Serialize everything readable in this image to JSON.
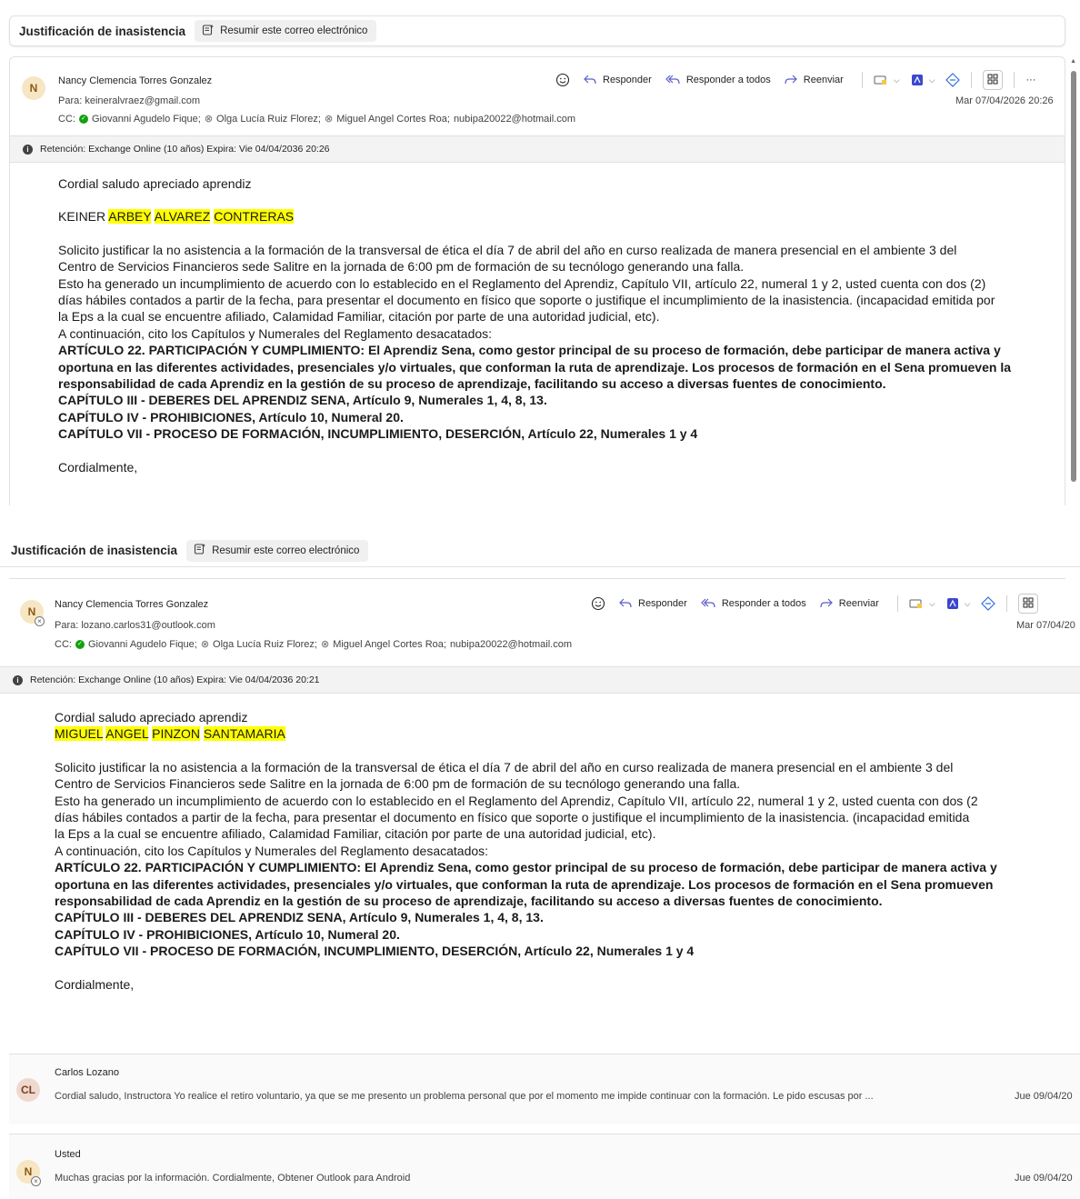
{
  "summarize_label": "Resumir este correo electrónico",
  "reply_label": "Responder",
  "reply_all_label": "Responder a todos",
  "forward_label": "Reenviar",
  "more_label": "···",
  "icons": [
    "smile-icon",
    "reply-icon",
    "reply-all-icon",
    "forward-icon",
    "flag-icon",
    "pdf-icon",
    "loop-icon",
    "apps-icon",
    "info-icon",
    "summarize-icon"
  ],
  "email1": {
    "subject": "Justificación de inasistencia",
    "avatar": "N",
    "sender": "Nancy Clemencia Torres Gonzalez",
    "to": "Para:  keineralvraez@gmail.com",
    "cc_label": "CC:",
    "cc": [
      "Giovanni Agudelo Fique;",
      "Olga Lucía Ruiz Florez;",
      "Miguel Angel Cortes Roa;",
      "nubipa20022@hotmail.com"
    ],
    "date": "Mar 07/04/2026 20:26",
    "retention": "Retención: Exchange Online (10 años) Expira: Vie 04/04/2036 20:26",
    "greeting": "Cordial saludo apreciado aprendiz",
    "name_parts": [
      "KEINER",
      "ARBEY",
      "ALVAREZ",
      "CONTRERAS"
    ],
    "para": [
      "Solicito justificar la no asistencia a la formación  de la transversal de ética el día 7 de abril  del año en curso realizada de manera presencial en el ambiente  3  del",
      "Centro de Servicios Financieros  sede Salitre en la jornada de 6:00 pm  de formación de su tecnólogo generando una falla.",
      "Esto ha generado un incumplimiento de acuerdo con lo establecido en el Reglamento del Aprendiz, Capítulo VII, artículo 22, numeral 1 y 2, usted cuenta con dos (2)",
      "días hábiles contados a partir de la fecha, para presentar el documento en físico que soporte o justifique el incumplimiento de la inasistencia. (incapacidad emitida por",
      "la Eps a la cual se encuentre afiliado, Calamidad Familiar, citación por parte de una autoridad judicial, etc).",
      "A continuación, cito los Capítulos y Numerales del Reglamento desacatados:"
    ],
    "bold": [
      "ARTÍCULO 22. PARTICIPACIÓN Y CUMPLIMIENTO: El Aprendiz Sena, como gestor principal de su proceso de formación, debe participar de manera activa y",
      "oportuna en las diferentes actividades, presenciales y/o virtuales, que conforman la ruta de aprendizaje. Los procesos de formación en el Sena promueven la",
      "responsabilidad de cada Aprendiz en la gestión de su proceso de aprendizaje, facilitando su acceso a diversas fuentes de conocimiento.",
      "CAPÍTULO III - DEBERES DEL APRENDIZ SENA, Artículo 9, Numerales 1, 4, 8, 13.",
      "CAPÍTULO IV - PROHIBICIONES, Artículo 10, Numeral 20.",
      "CAPÍTULO VII - PROCESO DE FORMACIÓN, INCUMPLIMIENTO, DESERCIÓN, Artículo 22, Numerales 1 y 4"
    ],
    "closing": "Cordialmente,"
  },
  "email2": {
    "subject": "Justificación de inasistencia",
    "avatar": "N",
    "sender": "Nancy Clemencia Torres Gonzalez",
    "to": "Para:  lozano.carlos31@outlook.com",
    "cc_label": "CC:",
    "cc": [
      "Giovanni Agudelo Fique;",
      "Olga Lucía Ruiz Florez;",
      "Miguel Angel Cortes Roa;",
      "nubipa20022@hotmail.com"
    ],
    "date": "Mar 07/04/20",
    "retention": "Retención: Exchange Online (10 años) Expira: Vie 04/04/2036 20:21",
    "greeting": "Cordial saludo apreciado aprendiz",
    "name_parts": [
      "MIGUEL",
      "ANGEL",
      "PINZON",
      "SANTAMARIA"
    ],
    "para": [
      "Solicito justificar la no asistencia a la formación  de la transversal de ética el día 7 de abril  del año en curso realizada de manera presencial en el ambiente  3  del",
      "Centro de Servicios Financieros  sede Salitre en la jornada de 6:00 pm  de formación de su tecnólogo generando una falla.",
      "Esto ha generado un incumplimiento de acuerdo con lo establecido en el Reglamento del Aprendiz, Capítulo VII, artículo 22, numeral 1 y 2, usted cuenta con dos (2",
      "días hábiles contados a partir de la fecha, para presentar el documento en físico que soporte o justifique el incumplimiento de la inasistencia. (incapacidad emitida",
      "la Eps a la cual se encuentre afiliado, Calamidad Familiar, citación por parte de una autoridad judicial, etc).",
      "A continuación, cito los Capítulos y Numerales del Reglamento desacatados:"
    ],
    "bold": [
      "ARTÍCULO 22. PARTICIPACIÓN Y CUMPLIMIENTO: El Aprendiz Sena, como gestor principal de su proceso de formación, debe participar de manera activa y",
      "oportuna en las diferentes actividades, presenciales y/o virtuales, que conforman la ruta de aprendizaje. Los procesos de formación en el Sena promueven",
      "responsabilidad de cada Aprendiz en la gestión de su proceso de aprendizaje, facilitando su acceso a diversas fuentes de conocimiento.",
      "CAPÍTULO III - DEBERES DEL APRENDIZ SENA, Artículo 9, Numerales 1, 4, 8, 13.",
      "CAPÍTULO IV - PROHIBICIONES, Artículo 10, Numeral 20.",
      "CAPÍTULO VII - PROCESO DE FORMACIÓN, INCUMPLIMIENTO, DESERCIÓN, Artículo 22, Numerales 1 y 4"
    ],
    "closing": "Cordialmente,"
  },
  "reply1": {
    "avatar": "CL",
    "name": "Carlos Lozano",
    "preview": "Cordial saludo, Instructora Yo realice el retiro voluntario, ya que se me presento un problema personal que por el momento me impide continuar con la formación. Le pido escusas por ...",
    "date": "Jue 09/04/20"
  },
  "reply2": {
    "avatar": "N",
    "name": "Usted",
    "preview": "Muchas gracias por la información. Cordialmente, Obtener Outlook para Android",
    "date": "Jue 09/04/20"
  }
}
